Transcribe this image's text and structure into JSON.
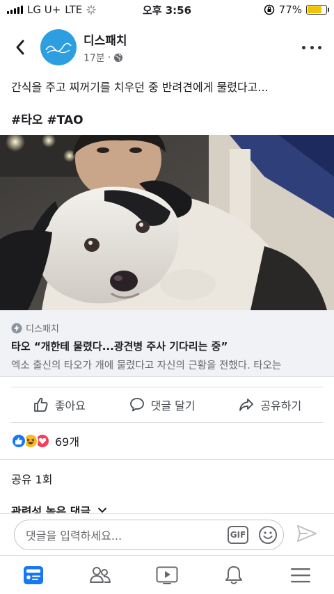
{
  "status_bar": {
    "carrier": "LG U+",
    "network": "LTE",
    "time": "오후 3:56",
    "battery_percent": "77%",
    "battery_level": 0.77
  },
  "post": {
    "page_name": "디스패치",
    "time": "17분",
    "separator": "·",
    "text": "간식을 주고 찌꺼기를 치우던 중 반려견에게 물렸다고...",
    "tags": "#타오 #TAO"
  },
  "link_preview": {
    "source": "디스패치",
    "title": "타오 “개한테 물렸다...광견병 주사 기다리는 중”",
    "description": "엑소 출신의 타오가 개에 물렸다고 자신의 근황을 전했다. 타오는"
  },
  "actions": {
    "like": "좋아요",
    "comment": "댓글 달기",
    "share": "공유하기"
  },
  "reactions": {
    "count": "69개",
    "types": [
      "like-icon",
      "haha-icon",
      "love-icon"
    ]
  },
  "shares": "공유 1회",
  "related_comments": "관련성 높은 댓글",
  "comment_bar": {
    "placeholder": "댓글을 입력하세요...",
    "gif_label": "GIF"
  },
  "tab_bar": {
    "items": [
      "news-feed-icon",
      "friends-icon",
      "watch-icon",
      "notifications-icon",
      "menu-icon"
    ]
  },
  "colors": {
    "accent": "#1877f2",
    "avatar_bg": "#2d9fe0",
    "battery": "#f2c300"
  }
}
